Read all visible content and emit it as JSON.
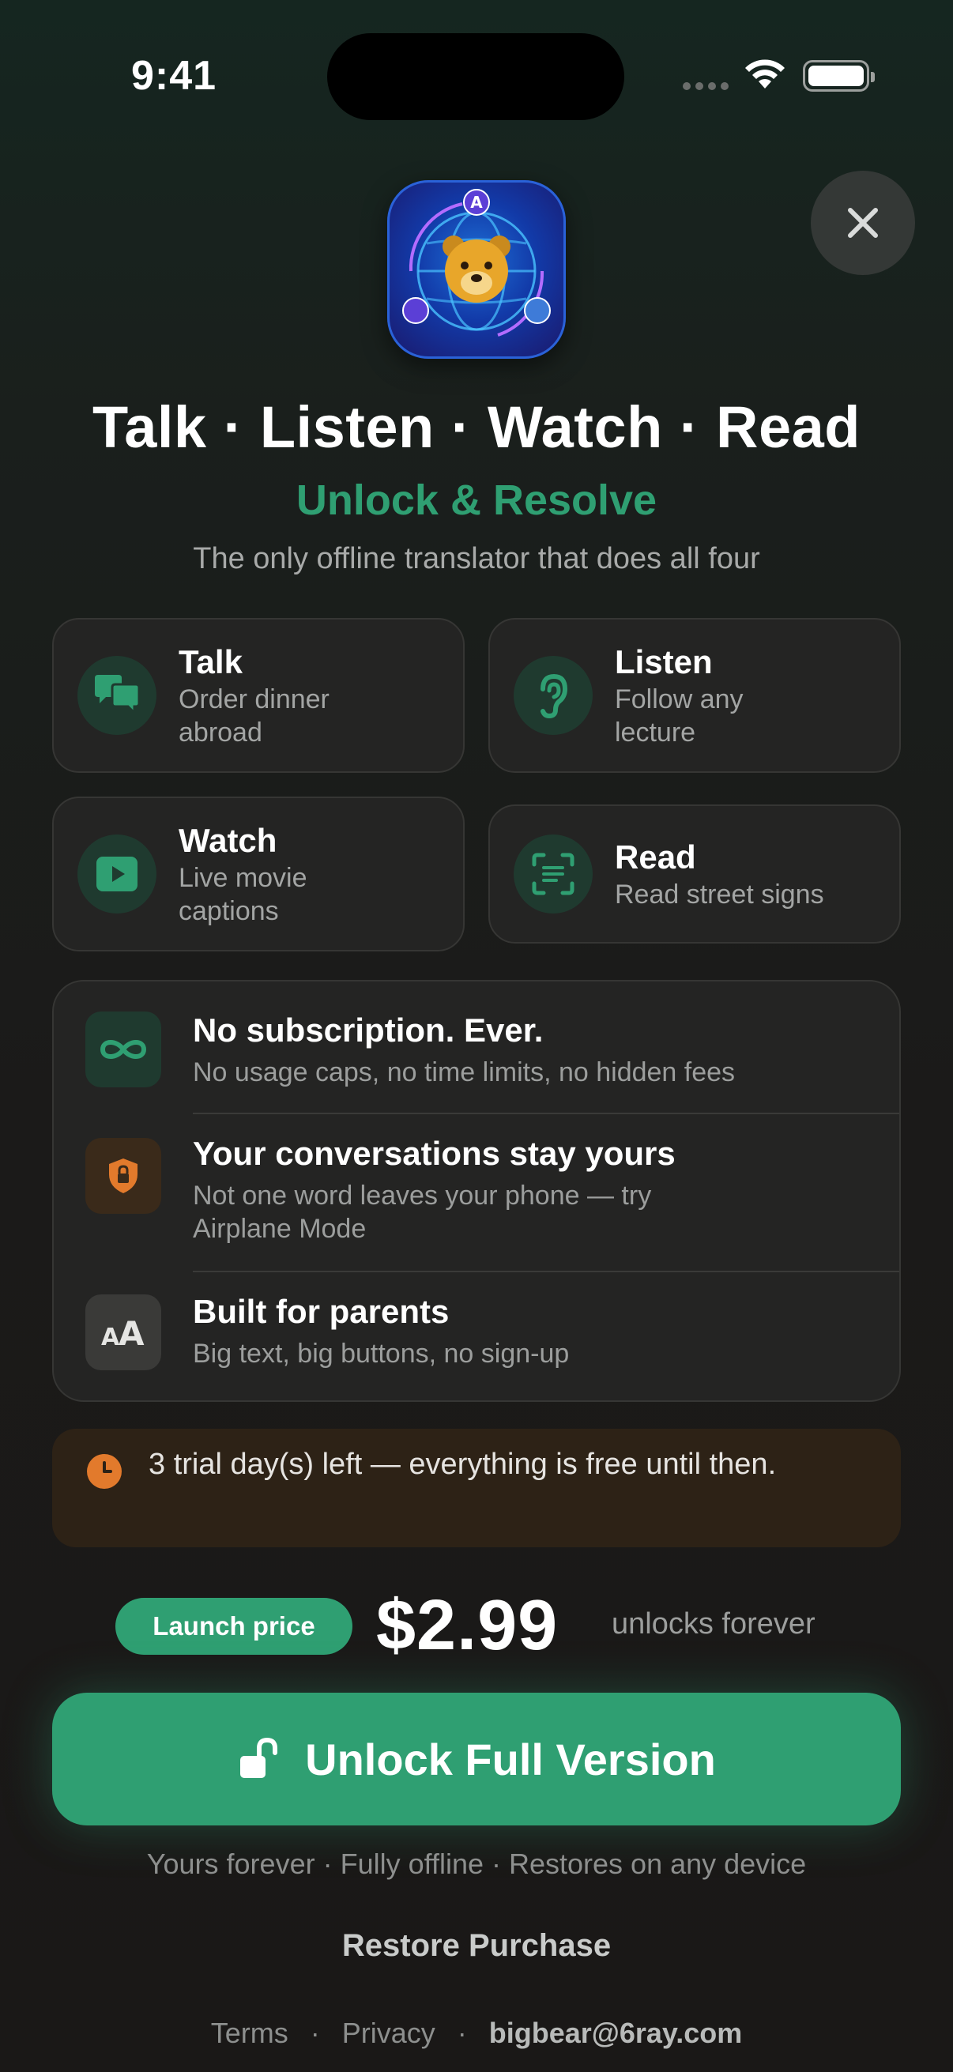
{
  "status_bar": {
    "time": "9:41"
  },
  "header": {
    "close_icon": "close-icon",
    "app_icon": "bear-globe-app-icon",
    "headline": "Talk · Listen · Watch · Read",
    "subhead": "Unlock & Resolve",
    "tagline": "The only offline translator that does all four"
  },
  "features": [
    {
      "title": "Talk",
      "subtitle": "Order dinner abroad",
      "icon": "chat-bubbles-icon"
    },
    {
      "title": "Listen",
      "subtitle": "Follow any lecture",
      "icon": "ear-icon"
    },
    {
      "title": "Watch",
      "subtitle": "Live movie captions",
      "icon": "play-icon"
    },
    {
      "title": "Read",
      "subtitle": "Read street signs",
      "icon": "scan-text-icon"
    }
  ],
  "benefits": [
    {
      "title": "No subscription. Ever.",
      "subtitle": "No usage caps, no time limits, no hidden fees",
      "icon": "infinity-icon"
    },
    {
      "title": "Your conversations stay yours",
      "subtitle": "Not one word leaves your phone — try Airplane Mode",
      "icon": "shield-lock-icon"
    },
    {
      "title": "Built for parents",
      "subtitle": "Big text, big buttons, no sign-up",
      "icon": "text-size-icon"
    }
  ],
  "trial": {
    "text": "3 trial day(s) left — everything is free until then.",
    "icon": "clock-icon"
  },
  "pricing": {
    "badge": "Launch price",
    "price": "$2.99",
    "note": "unlocks forever"
  },
  "cta": {
    "label": "Unlock Full Version",
    "icon": "unlock-icon"
  },
  "footer": {
    "note": "Yours forever · Fully offline · Restores on any device",
    "restore": "Restore Purchase",
    "terms": "Terms",
    "privacy": "Privacy",
    "separator": "·",
    "email": "bigbear@6ray.com"
  },
  "colors": {
    "accent": "#2f9f72",
    "background": "#1b1a19",
    "trial_bg": "#2d2216",
    "trial_icon": "#e27a2c"
  }
}
